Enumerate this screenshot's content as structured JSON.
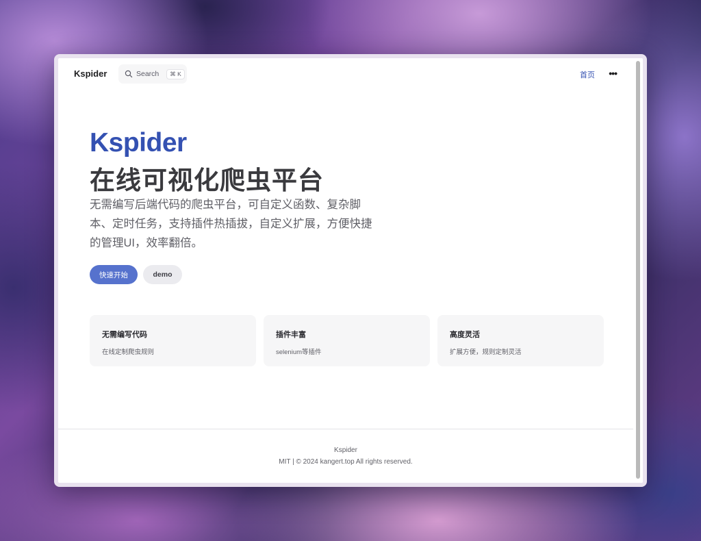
{
  "nav": {
    "title": "Kspider",
    "search": {
      "label": "Search",
      "shortcut": "⌘ K"
    },
    "links": [
      {
        "label": "首页"
      }
    ],
    "more": "•••"
  },
  "hero": {
    "name": "Kspider",
    "text": "在线可视化爬虫平台",
    "tagline": "无需编写后端代码的爬虫平台，可自定义函数、复杂脚本、定时任务，支持插件热插拔，自定义扩展，方便快捷的管理UI，效率翻倍。",
    "actions": [
      {
        "label": "快速开始"
      },
      {
        "label": "demo"
      }
    ]
  },
  "features": [
    {
      "title": "无需编写代码",
      "details": "在线定制爬虫规则"
    },
    {
      "title": "插件丰富",
      "details": "selenium等插件"
    },
    {
      "title": "高度灵活",
      "details": "扩展方便，规则定制灵活"
    }
  ],
  "footer": {
    "name": "Kspider",
    "copyright": "MIT | © 2024 kangert.top All rights reserved."
  },
  "colors": {
    "brand": "#3451b2",
    "button": "#5672cd"
  }
}
